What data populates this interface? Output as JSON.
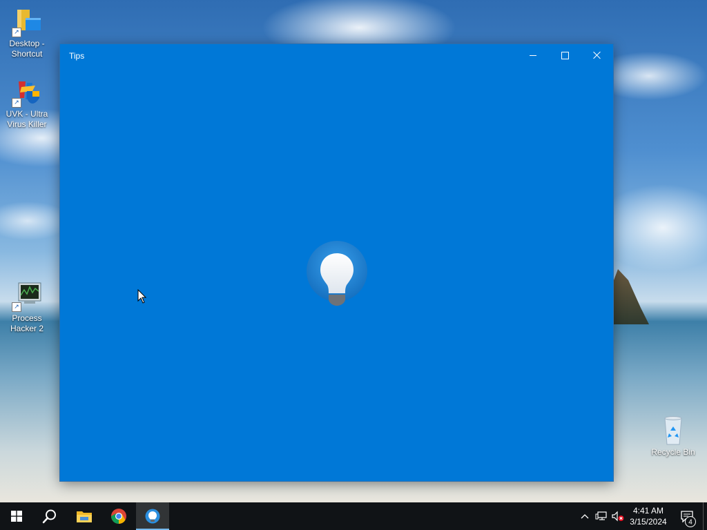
{
  "desktop": {
    "icons": [
      {
        "label": "Desktop - Shortcut",
        "icon": "folder-shortcut-icon"
      },
      {
        "label": "UVK - Ultra Virus Killer",
        "icon": "uvk-icon"
      },
      {
        "label": "Process Hacker 2",
        "icon": "process-hacker-icon"
      },
      {
        "label": "Recycle Bin",
        "icon": "recycle-bin-icon"
      }
    ]
  },
  "window": {
    "title": "Tips",
    "splash_icon": "lightbulb-icon",
    "background_color": "#0078d7"
  },
  "taskbar": {
    "items": [
      {
        "name": "start",
        "icon": "windows-start-icon"
      },
      {
        "name": "search",
        "icon": "search-icon"
      },
      {
        "name": "file-explorer",
        "icon": "folder-icon"
      },
      {
        "name": "chrome",
        "icon": "chrome-icon"
      },
      {
        "name": "tips",
        "icon": "lightbulb-icon",
        "active": true
      }
    ],
    "tray": {
      "time": "4:41 AM",
      "date": "3/15/2024",
      "notification_count": "4"
    }
  }
}
